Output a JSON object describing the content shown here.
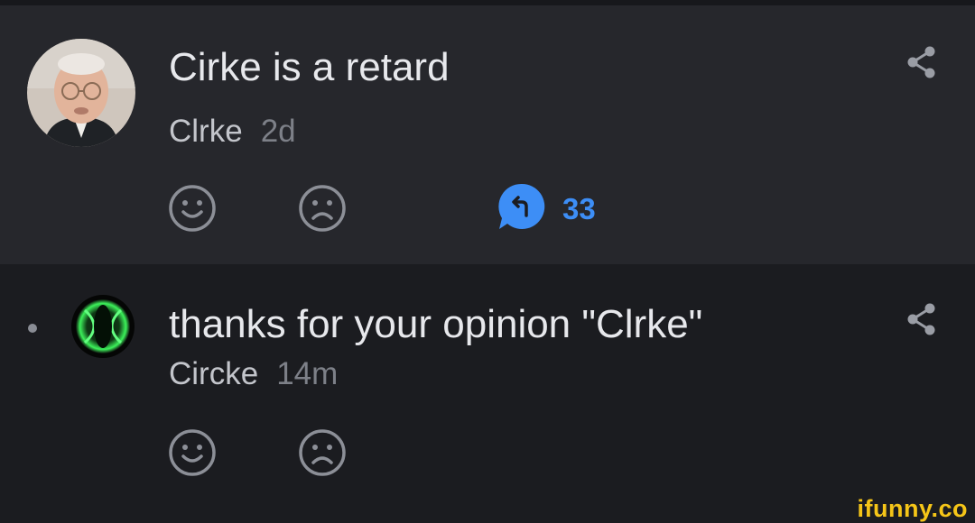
{
  "comments": [
    {
      "text": "Cirke is a retard",
      "author": "Clrke",
      "time": "2d",
      "reply_count": "33"
    },
    {
      "text": "thanks for your opinion \"Clrke\"",
      "author": "Circke",
      "time": "14m"
    }
  ],
  "icons": {
    "share": "share-icon",
    "smile": "smile-icon",
    "frown": "frown-icon",
    "reply": "reply-bubble-icon"
  },
  "colors": {
    "background": "#1b1c20",
    "highlight_background": "#26272c",
    "accent": "#3d8ef6",
    "watermark": "#f5c518"
  },
  "watermark": "ifunny.co"
}
